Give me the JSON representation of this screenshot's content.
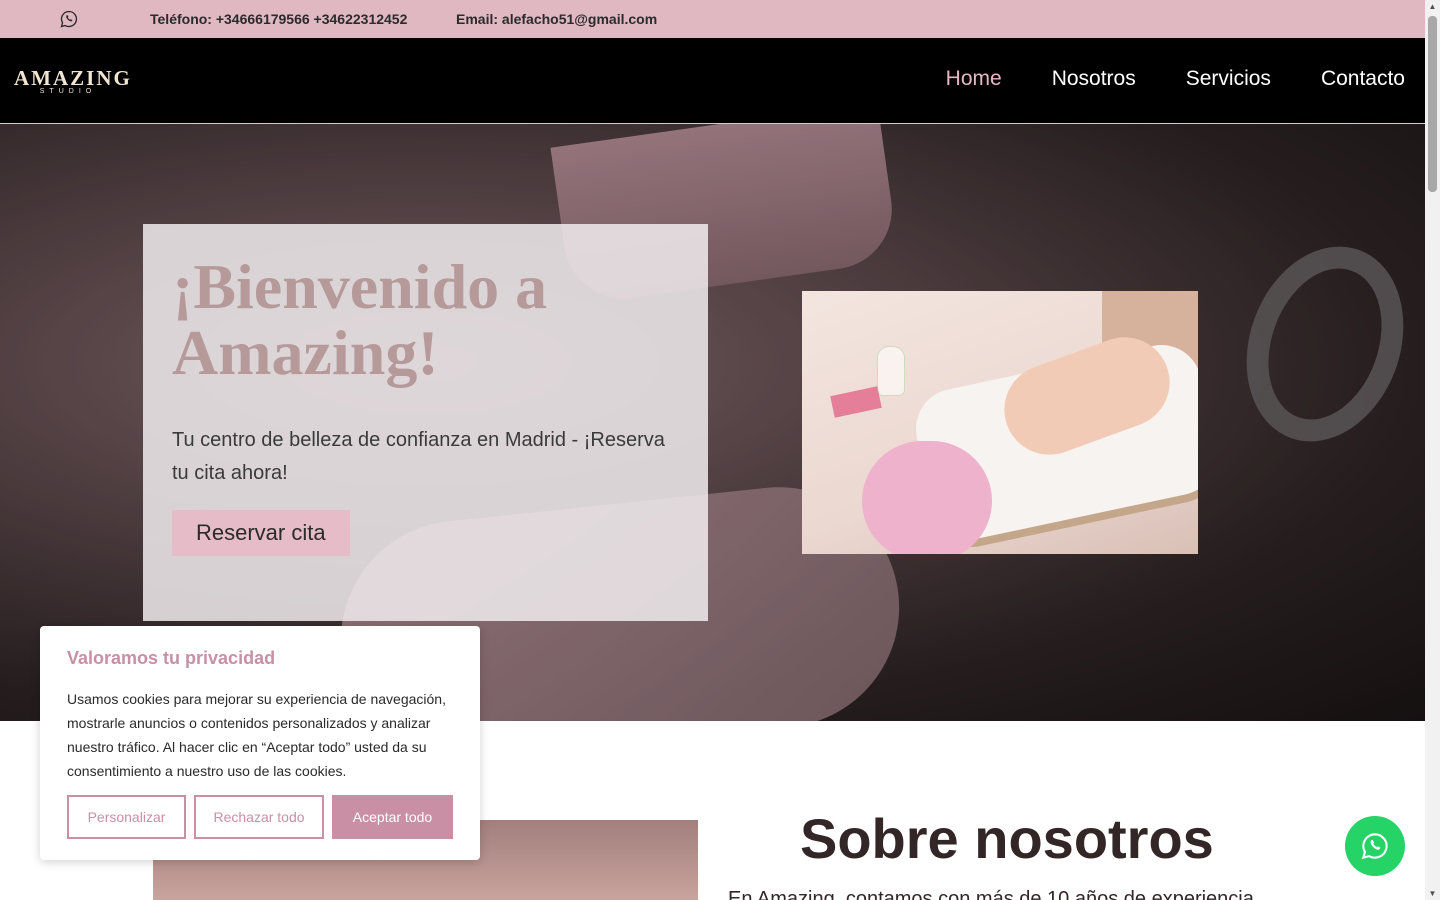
{
  "topbar": {
    "phone": "Teléfono: +34666179566 +34622312452",
    "email": "Email: alefacho51@gmail.com"
  },
  "brand": {
    "name": "AMAZING",
    "tagline": "STUDIO"
  },
  "nav": {
    "items": [
      {
        "label": "Home",
        "active": true
      },
      {
        "label": "Nosotros",
        "active": false
      },
      {
        "label": "Servicios",
        "active": false
      },
      {
        "label": "Contacto",
        "active": false
      }
    ]
  },
  "hero": {
    "title": "¡Bienvenido a Amazing!",
    "subtitle": "Tu centro de belleza de confianza en Madrid - ¡Reserva tu cita ahora!",
    "cta": "Reservar cita"
  },
  "about": {
    "title": "Sobre nosotros",
    "text": "En Amazing, contamos con más de 10 años de experiencia"
  },
  "cookie": {
    "title": "Valoramos tu privacidad",
    "body": "Usamos cookies para mejorar su experiencia de navegación, mostrarle anuncios o contenidos personalizados y analizar nuestro tráfico. Al hacer clic en “Aceptar todo” usted da su consentimiento a nuestro uso de las cookies.",
    "customize": "Personalizar",
    "reject": "Rechazar todo",
    "accept": "Aceptar todo"
  },
  "colors": {
    "accent": "#dfb8c2",
    "cookie_accent": "#c98fa5",
    "whatsapp": "#25d366",
    "hero_title": "#b69a9a"
  },
  "icons": {
    "topbar": "whatsapp-icon",
    "floating": "whatsapp-icon"
  }
}
